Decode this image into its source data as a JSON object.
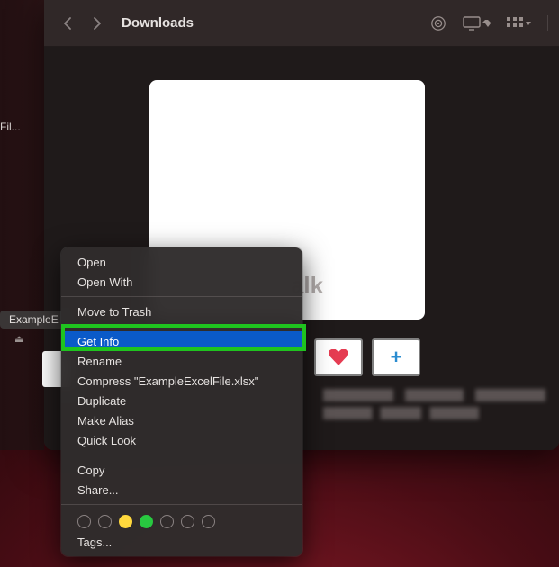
{
  "window": {
    "title": "Downloads"
  },
  "sidebar": {
    "truncated_label": "Fil...",
    "selected_item_truncated": "ExampleE",
    "eject_glyph": "⏏"
  },
  "thumbs": [
    {
      "kind": "heart"
    },
    {
      "kind": "plus"
    }
  ],
  "context_menu": {
    "items": [
      {
        "label": "Open",
        "highlighted": false
      },
      {
        "label": "Open With",
        "highlighted": false,
        "sep_after": true
      },
      {
        "label": "Move to Trash",
        "highlighted": false,
        "sep_after": true
      },
      {
        "label": "Get Info",
        "highlighted": true
      },
      {
        "label": "Rename",
        "highlighted": false
      },
      {
        "label": "Compress \"ExampleExcelFile.xlsx\"",
        "highlighted": false
      },
      {
        "label": "Duplicate",
        "highlighted": false
      },
      {
        "label": "Make Alias",
        "highlighted": false
      },
      {
        "label": "Quick Look",
        "highlighted": false,
        "sep_after": true
      },
      {
        "label": "Copy",
        "highlighted": false
      },
      {
        "label": "Share...",
        "highlighted": false,
        "sep_after": true
      }
    ],
    "tags_label": "Tags...",
    "tag_colors": [
      "plain",
      "plain",
      "yellow",
      "green",
      "plain",
      "plain",
      "plain"
    ]
  },
  "watermark": "iTechTalk",
  "annotation": {
    "highlighted_item_label": "Get Info"
  }
}
